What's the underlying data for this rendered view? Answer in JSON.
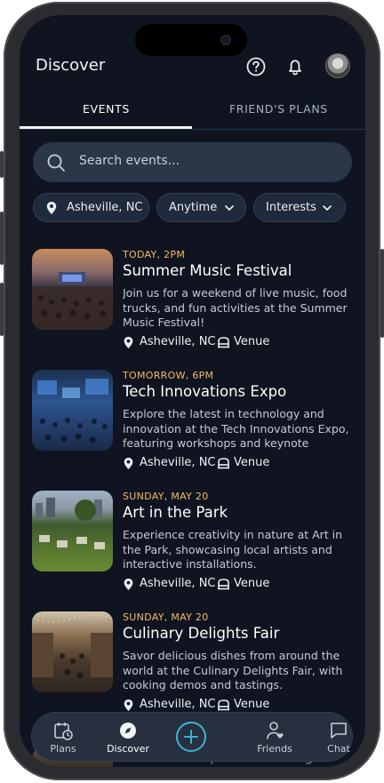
{
  "header": {
    "title": "Discover",
    "icons": [
      "help-icon",
      "bell-icon",
      "avatar"
    ]
  },
  "tabs": [
    {
      "label": "EVENTS",
      "active": true
    },
    {
      "label": "FRIEND'S PLANS",
      "active": false
    }
  ],
  "search": {
    "placeholder": "Search events..."
  },
  "filters": [
    {
      "label": "Asheville, NC",
      "icon": "location-pin-icon"
    },
    {
      "label": "Anytime",
      "icon": "chevron-down-icon"
    },
    {
      "label": "Interests",
      "icon": "chevron-down-icon"
    }
  ],
  "events": [
    {
      "when": "TODAY, 2PM",
      "name": "Summer Music Festival",
      "description": "Join us for a weekend of live music, food trucks, and fun activities at the Summer Music Festival!",
      "location": "Asheville, NC",
      "venue": "Venue"
    },
    {
      "when": "TOMORROW, 6PM",
      "name": "Tech Innovations Expo",
      "description": "Explore the latest in technology and innovation at the Tech Innovations Expo, featuring workshops and keynote speake...",
      "location": "Asheville, NC",
      "venue": "Venue"
    },
    {
      "when": "SUNDAY, MAY 20",
      "name": "Art in the Park",
      "description": "Experience creativity in nature at Art in the Park, showcasing local artists and interactive installations.",
      "location": "Asheville, NC",
      "venue": "Venue"
    },
    {
      "when": "SUNDAY, MAY 20",
      "name": "Culinary Delights Fair",
      "description": "Savor delicious dishes from around the world at the Culinary Delights Fair, with cooking demos and tastings.",
      "location": "Asheville, NC",
      "venue": "Venue"
    }
  ],
  "partial_event": {
    "name": "Adventure Sports Challenge"
  },
  "tabbar": [
    {
      "label": "Plans",
      "icon": "calendar-clock-icon"
    },
    {
      "label": "Discover",
      "icon": "compass-icon",
      "active": true
    },
    {
      "label": "",
      "icon": "plus-icon"
    },
    {
      "label": "Friends",
      "icon": "person-heart-icon"
    },
    {
      "label": "Chat",
      "icon": "chat-bubble-icon"
    }
  ],
  "colors": {
    "background": "#0f1420",
    "accent_time": "#f5b963",
    "accent_plus": "#3fb2d6"
  }
}
